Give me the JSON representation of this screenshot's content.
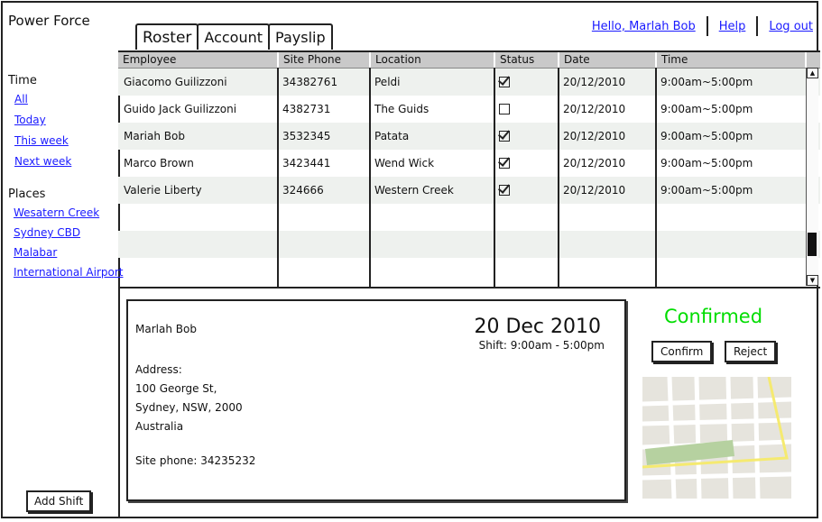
{
  "app": {
    "title": "Power Force"
  },
  "topnav": {
    "user": "Hello, Marlah Bob",
    "help": "Help",
    "logout": "Log out"
  },
  "tabs": [
    {
      "label": "Roster"
    },
    {
      "label": "Account"
    },
    {
      "label": "Payslip"
    }
  ],
  "sidebar": {
    "time_heading": "Time",
    "time_links": [
      "All",
      "Today",
      "This week",
      "Next week"
    ],
    "places_heading": "Places",
    "place_links": [
      "Wesatern Creek",
      "Sydney CBD",
      "Malabar",
      "International Airport"
    ],
    "add_shift": "Add Shift"
  },
  "grid": {
    "columns": [
      "Employee",
      "Site Phone",
      "Location",
      "Status",
      "Date",
      "Time"
    ],
    "rows": [
      {
        "employee": "Giacomo Guilizzoni",
        "phone": "34382761",
        "location": "Peldi",
        "status": true,
        "date": "20/12/2010",
        "time": "9:00am~5:00pm"
      },
      {
        "employee": "Guido Jack Guilizzoni",
        "phone": "4382731",
        "location": "The Guids",
        "status": false,
        "date": "20/12/2010",
        "time": "9:00am~5:00pm"
      },
      {
        "employee": "Mariah Bob",
        "phone": "3532345",
        "location": "Patata",
        "status": true,
        "date": "20/12/2010",
        "time": "9:00am~5:00pm"
      },
      {
        "employee": "Marco Brown",
        "phone": "3423441",
        "location": "Wend Wick",
        "status": true,
        "date": "20/12/2010",
        "time": "9:00am~5:00pm"
      },
      {
        "employee": "Valerie Liberty",
        "phone": "324666",
        "location": "Western Creek",
        "status": true,
        "date": "20/12/2010",
        "time": "9:00am~5:00pm"
      }
    ]
  },
  "detail": {
    "name": "Marlah Bob",
    "date": "20 Dec 2010",
    "shift": "Shift: 9:00am - 5:00pm",
    "address_label": "Address:",
    "address_lines": [
      "100 George St,",
      "Sydney, NSW, 2000",
      "Australia"
    ],
    "site_phone": "Site phone: 34235232",
    "status": "Confirmed",
    "confirm": "Confirm",
    "reject": "Reject"
  },
  "colors": {
    "link": "#1a1aff",
    "confirmed": "#00dd00"
  }
}
